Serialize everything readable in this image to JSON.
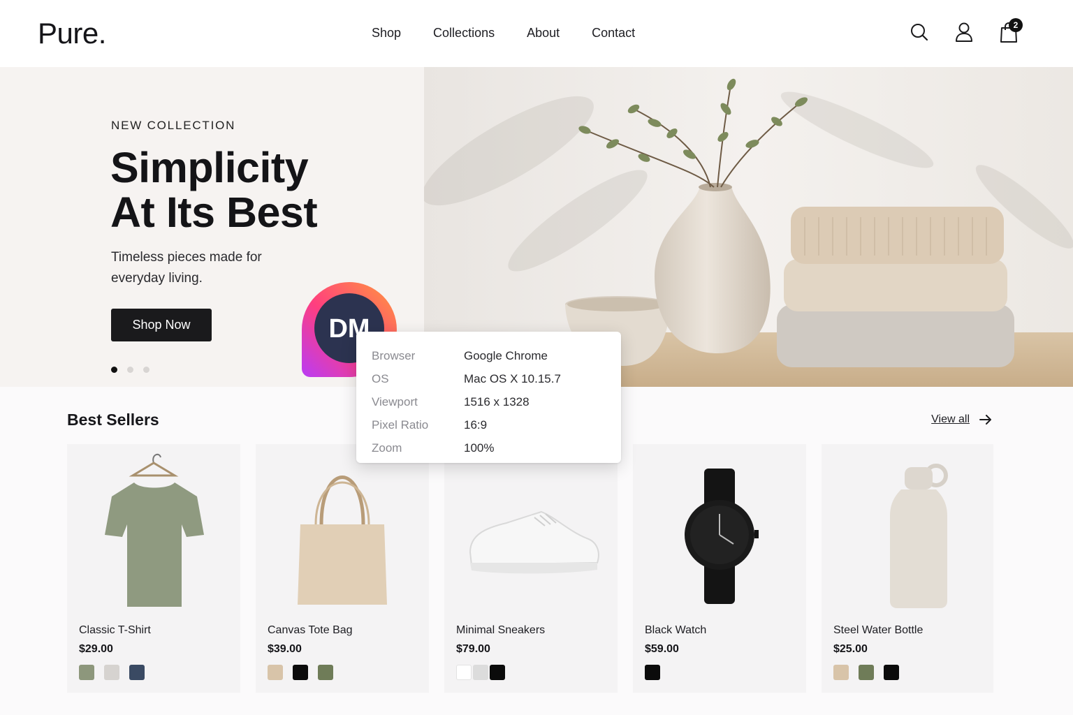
{
  "header": {
    "logo": "Pure.",
    "nav": [
      "Shop",
      "Collections",
      "About",
      "Contact"
    ],
    "icons": [
      "search-icon",
      "user-icon",
      "shopping-bag-icon"
    ],
    "cart_count": "2"
  },
  "hero": {
    "eyebrow": "NEW COLLECTION",
    "title_line1": "Simplicity",
    "title_line2": "At Its Best",
    "subtitle": "Timeless pieces made for everyday living.",
    "cta": "Shop Now",
    "slides": 3,
    "active_slide": 1
  },
  "badge": {
    "initials": "DM"
  },
  "best_sellers": {
    "title": "Best Sellers",
    "view_all": "View all",
    "products": [
      {
        "name": "Classic T-Shirt",
        "price": "$29.00",
        "colors": [
          "#8d977c",
          "#d6d3d0",
          "#3a4a63"
        ]
      },
      {
        "name": "Canvas Tote Bag",
        "price": "$39.00",
        "colors": [
          "#d8c4a9",
          "#0c0c0c",
          "#6f7c58"
        ]
      },
      {
        "name": "Minimal Sneakers",
        "price": "$79.00",
        "colors": [
          "#ffffff",
          "#dcdcdc",
          "#0b0b0b"
        ]
      },
      {
        "name": "Black Watch",
        "price": "$59.00",
        "colors": [
          "#0b0b0b"
        ]
      },
      {
        "name": "Steel Water Bottle",
        "price": "$25.00",
        "colors": [
          "#d8c4a9",
          "#6f7c58",
          "#0b0b0b"
        ]
      }
    ]
  },
  "env_tooltip": {
    "rows": [
      {
        "key": "Browser",
        "value": "Google Chrome"
      },
      {
        "key": "OS",
        "value": "Mac OS X 10.15.7"
      },
      {
        "key": "Viewport",
        "value": "1516 x 1328"
      },
      {
        "key": "Pixel Ratio",
        "value": "16:9"
      },
      {
        "key": "Zoom",
        "value": "100%"
      }
    ]
  }
}
